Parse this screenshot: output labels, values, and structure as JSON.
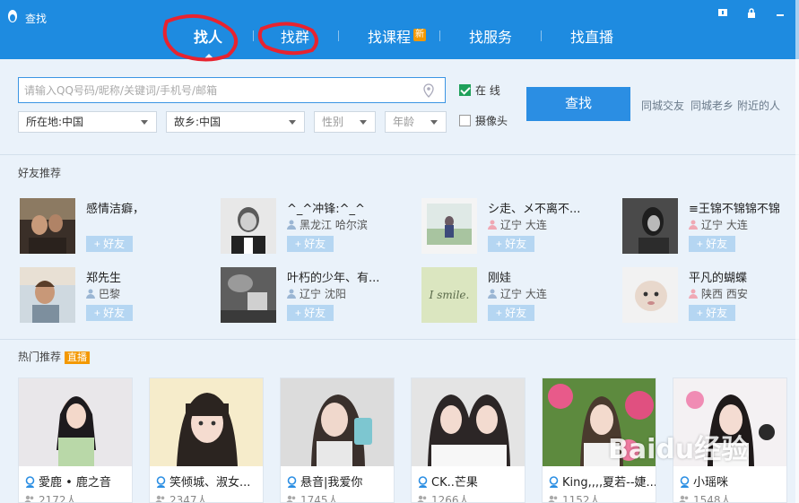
{
  "window": {
    "title": "查找",
    "controls": [
      "help-icon",
      "lock-icon",
      "minimize-icon"
    ]
  },
  "nav": {
    "tabs": [
      {
        "label": "找人",
        "active": true
      },
      {
        "label": "找群",
        "active": false
      },
      {
        "label": "找课程",
        "active": false,
        "badge": "新"
      },
      {
        "label": "找服务",
        "active": false
      },
      {
        "label": "找直播",
        "active": false
      }
    ],
    "separator": "|"
  },
  "search": {
    "placeholder": "请输入QQ号码/昵称/关键词/手机号/邮箱",
    "value": "",
    "location_label": "所在地:中国",
    "hometown_label": "故乡:中国",
    "gender_placeholder": "性别",
    "age_placeholder": "年龄",
    "online_label": "在  线",
    "online_checked": true,
    "camera_label": "摄像头",
    "camera_checked": false,
    "find_label": "查找",
    "quick_links": [
      "同城交友",
      "同城老乡",
      "附近的人"
    ]
  },
  "friends": {
    "title": "好友推荐",
    "add_label": "+ 好友",
    "items": [
      {
        "name": "感情洁癖，",
        "location": ""
      },
      {
        "name": "^_^冲锋:^_^",
        "location": "黑龙江  哈尔滨"
      },
      {
        "name": "シ走、メ不离不...",
        "location": "辽宁  大连"
      },
      {
        "name": "≡王锦不锦锦不锦",
        "location": "辽宁  大连"
      },
      {
        "name": "郑先生",
        "location": "巴黎"
      },
      {
        "name": "叶朽的少年、有...",
        "location": "辽宁  沈阳"
      },
      {
        "name": "刚娃",
        "location": "辽宁  大连"
      },
      {
        "name": "平凡的蝴蝶",
        "location": "陕西  西安"
      }
    ],
    "smile_text": "I smile."
  },
  "hot": {
    "title": "热门推荐",
    "badge": "直播",
    "items": [
      {
        "name": "愛鹿 • 鹿之音",
        "count": "2172人"
      },
      {
        "name": "笑倾城、淑女...",
        "count": "2347人"
      },
      {
        "name": "悬音|我爱你",
        "count": "1745人"
      },
      {
        "name": "CK..芒果",
        "count": "1266人"
      },
      {
        "name": "King,,,,夏若--婕...",
        "count": "1152人"
      },
      {
        "name": "小瑶咪",
        "count": "1548人"
      }
    ]
  },
  "watermark": "Baidu经验",
  "colors": {
    "titlebar": "#1e8be0",
    "accent": "#2b8ee3",
    "badge": "#f39800",
    "annotation": "#e8232f"
  }
}
